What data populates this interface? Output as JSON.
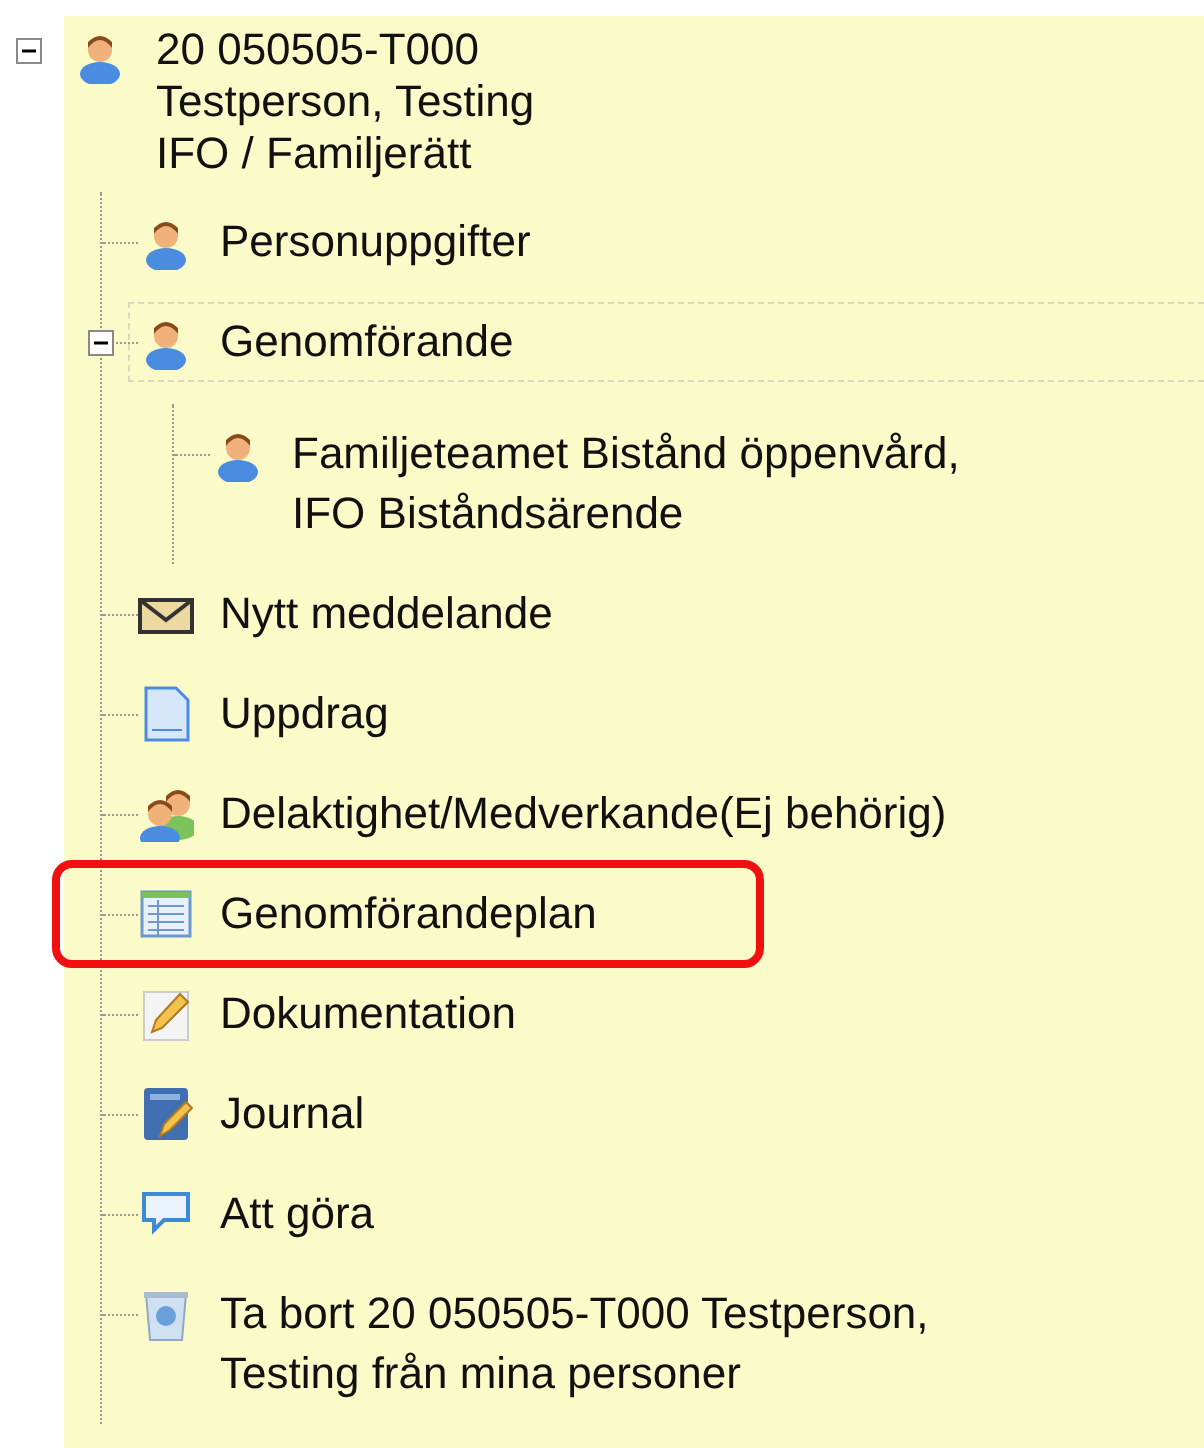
{
  "tree": {
    "root": {
      "kind": "person",
      "expanded": true,
      "lines": [
        "20 050505-T000",
        "Testperson, Testing",
        "IFO / Familjerätt"
      ],
      "children": [
        {
          "label": "Personuppgifter",
          "kind": "person",
          "focused": false,
          "highlighted": false
        },
        {
          "label": "Genomförande",
          "kind": "person",
          "focused": true,
          "highlighted": false,
          "expanded": true,
          "children": [
            {
              "label": "Familjeteamet Bistånd öppenvård,\nIFO Biståndsärende",
              "kind": "person",
              "focused": false,
              "highlighted": false
            }
          ]
        },
        {
          "label": "Nytt meddelande",
          "kind": "envelope",
          "focused": false,
          "highlighted": false
        },
        {
          "label": "Uppdrag",
          "kind": "document",
          "focused": false,
          "highlighted": false
        },
        {
          "label": "Delaktighet/Medverkande(Ej behörig)",
          "kind": "people",
          "focused": false,
          "highlighted": false
        },
        {
          "label": "Genomförandeplan",
          "kind": "table",
          "focused": false,
          "highlighted": true
        },
        {
          "label": "Dokumentation",
          "kind": "pencil",
          "focused": false,
          "highlighted": false
        },
        {
          "label": "Journal",
          "kind": "journal",
          "focused": false,
          "highlighted": false
        },
        {
          "label": "Att göra",
          "kind": "speech",
          "focused": false,
          "highlighted": false
        },
        {
          "label": "Ta bort 20 050505-T000 Testperson,\nTesting från mina personer",
          "kind": "trash",
          "focused": false,
          "highlighted": false
        }
      ]
    }
  }
}
